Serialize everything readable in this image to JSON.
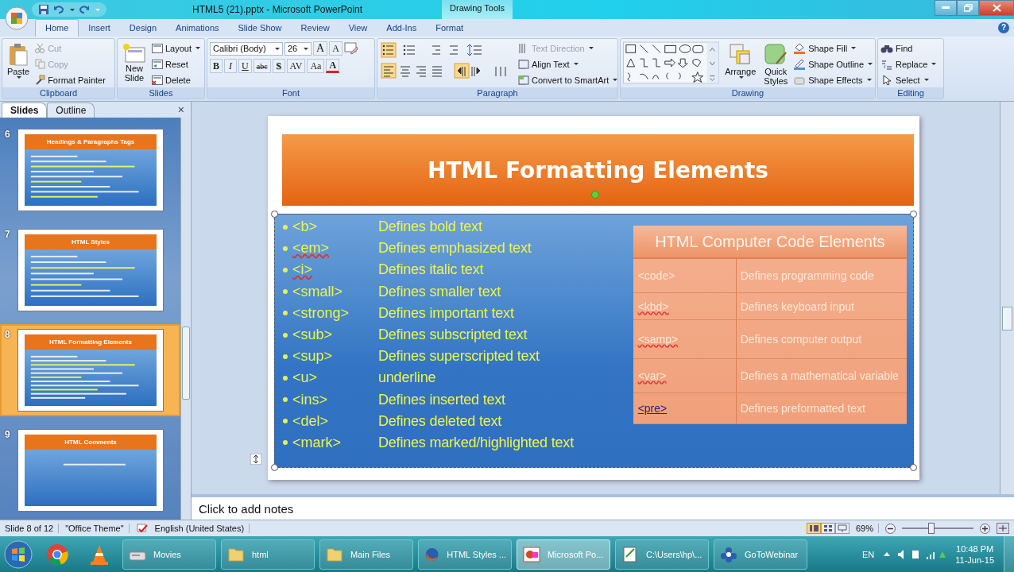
{
  "window": {
    "title": "HTML5 (21).pptx - Microsoft PowerPoint",
    "context_group": "Drawing Tools",
    "help": "?"
  },
  "tabs": [
    {
      "label": "Home",
      "selected": true
    },
    {
      "label": "Insert",
      "selected": false
    },
    {
      "label": "Design",
      "selected": false
    },
    {
      "label": "Animations",
      "selected": false
    },
    {
      "label": "Slide Show",
      "selected": false
    },
    {
      "label": "Review",
      "selected": false
    },
    {
      "label": "View",
      "selected": false
    },
    {
      "label": "Add-Ins",
      "selected": false
    },
    {
      "label": "Format",
      "selected": false
    }
  ],
  "ribbon": {
    "clipboard": {
      "title": "Clipboard",
      "paste": "Paste",
      "commands": [
        {
          "label": "Cut",
          "disabled": true
        },
        {
          "label": "Copy",
          "disabled": true
        },
        {
          "label": "Format Painter",
          "disabled": false
        }
      ]
    },
    "slides": {
      "title": "Slides",
      "new_slide": [
        "New",
        "Slide"
      ],
      "commands": [
        {
          "label": "Layout"
        },
        {
          "label": "Reset"
        },
        {
          "label": "Delete"
        }
      ]
    },
    "font": {
      "title": "Font",
      "font_name": "Calibri (Body)",
      "font_size": "26",
      "grow": "A",
      "shrink": "A",
      "format_buttons": [
        "B",
        "I",
        "U",
        "abc",
        "S",
        "AV",
        "Aa",
        "A"
      ]
    },
    "paragraph": {
      "title": "Paragraph",
      "commands": [
        {
          "label": "Text Direction",
          "disabled": true
        },
        {
          "label": "Align Text",
          "disabled": false
        },
        {
          "label": "Convert to SmartArt",
          "disabled": false
        }
      ]
    },
    "drawing": {
      "title": "Drawing",
      "arrange": "Arrange",
      "quick_styles": [
        "Quick",
        "Styles"
      ],
      "commands": [
        "Shape Fill",
        "Shape Outline",
        "Shape Effects"
      ]
    },
    "editing": {
      "title": "Editing",
      "commands": [
        "Find",
        "Replace",
        "Select"
      ]
    }
  },
  "slides_pane": {
    "tabs": [
      {
        "label": "Slides",
        "selected": true
      },
      {
        "label": "Outline",
        "selected": false
      }
    ],
    "close": "×",
    "thumbnails": [
      {
        "number": "6",
        "title": "Headings & Paragraphs Tags",
        "selected": false
      },
      {
        "number": "7",
        "title": "HTML Styles",
        "selected": false
      },
      {
        "number": "8",
        "title": "HTML Formatting Elements",
        "selected": true
      },
      {
        "number": "9",
        "title": "HTML Comments",
        "selected": false
      }
    ]
  },
  "slide": {
    "title": "HTML Formatting Elements",
    "items": [
      {
        "tag": "<b>",
        "description": "Defines bold text",
        "misspelled": false
      },
      {
        "tag": "<em>",
        "description": "Defines emphasized text",
        "misspelled": true
      },
      {
        "tag": "<i>",
        "description": "Defines italic text",
        "misspelled": true
      },
      {
        "tag": "<small>",
        "description": "Defines smaller text",
        "misspelled": false
      },
      {
        "tag": "<strong>",
        "description": "Defines important text",
        "misspelled": false
      },
      {
        "tag": "<sub>",
        "description": "Defines subscripted text",
        "misspelled": false
      },
      {
        "tag": "<sup>",
        "description": "Defines superscripted text",
        "misspelled": false
      },
      {
        "tag": "<u>",
        "description": "underline",
        "misspelled": false
      },
      {
        "tag": "<ins>",
        "description": "Defines inserted text",
        "misspelled": false
      },
      {
        "tag": "<del>",
        "description": "Defines deleted text",
        "misspelled": false
      },
      {
        "tag": "<mark>",
        "description": "Defines marked/highlighted text",
        "misspelled": false
      }
    ],
    "table": {
      "title": "HTML Computer Code Elements",
      "rows": [
        {
          "tag": "<code>",
          "description": "Defines programming code",
          "misspelled": false,
          "underlined": false
        },
        {
          "tag": "<kbd>",
          "description": "Defines keyboard input",
          "misspelled": true,
          "underlined": false
        },
        {
          "tag": "<samp>",
          "description": "Defines computer output",
          "misspelled": true,
          "underlined": false
        },
        {
          "tag": "<var>",
          "description": "Defines a mathematical variable",
          "misspelled": true,
          "underlined": false
        },
        {
          "tag": "<pre>",
          "description": "Defines preformatted text",
          "misspelled": false,
          "underlined": true
        }
      ]
    }
  },
  "notes": {
    "placeholder": "Click to add notes"
  },
  "status_bar": {
    "slide": "Slide 8 of 12",
    "theme": "\"Office Theme\"",
    "language": "English (United States)",
    "zoom": "69%",
    "zoom_slider": {
      "level": 0.4
    }
  },
  "taskbar": {
    "items": [
      {
        "label": "Movies",
        "selected": false
      },
      {
        "label": "html",
        "selected": false
      },
      {
        "label": "Main Files",
        "selected": false
      },
      {
        "label": "HTML Styles ...",
        "selected": false
      },
      {
        "label": "Microsoft Po...",
        "selected": true
      },
      {
        "label": "C:\\Users\\hp\\...",
        "selected": false
      },
      {
        "label": "GoToWebinar",
        "selected": false
      }
    ],
    "language": "EN",
    "time": "10:48 PM",
    "date": "11-Jun-15"
  }
}
